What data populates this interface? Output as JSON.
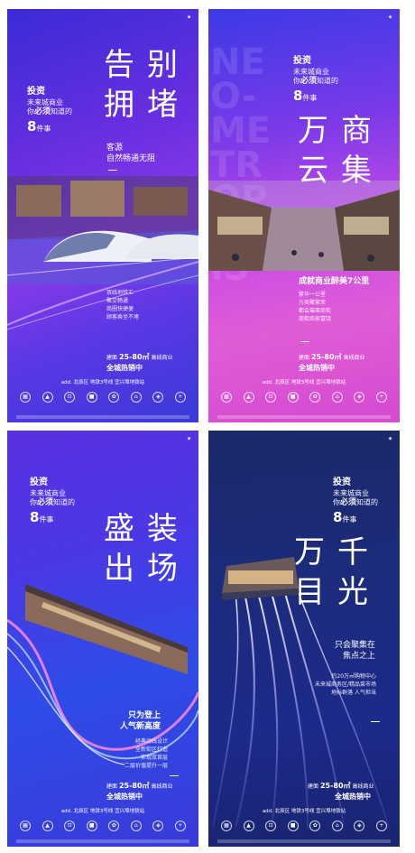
{
  "common": {
    "intro_title": "投资",
    "intro_line1": "未来城商业",
    "intro_line2_pre": "你",
    "intro_line2_bold": "必须",
    "intro_line2_post": "知道的",
    "intro_num": "8",
    "intro_suffix": "件事",
    "price_pre": "建面",
    "price_range": "25-80㎡",
    "price_post": "高线商业",
    "sale": "全城热销中",
    "address": "add. 北辰区 地铁3号线 宜兴埠地铁站"
  },
  "p1": {
    "title_chars": [
      "告",
      "别",
      "拥",
      "堵"
    ],
    "subtitle1": "客源",
    "subtitle2": "自然畅通无阻",
    "lines": [
      "双线地铁汇",
      "聚交畅通",
      "商圈快捷便",
      "顾客乘坐不堵"
    ]
  },
  "p2": {
    "watermark": "NEO-METROPOLIS",
    "title_chars": [
      "万",
      "商",
      "云",
      "集"
    ],
    "subtitle": "成就商业醉美7公里",
    "lines": [
      "繁华一公里",
      "万商聚繁荣",
      "都会璀璨商街",
      "商街商家富饶"
    ]
  },
  "p3": {
    "title_chars": [
      "盛",
      "装",
      "出",
      "场"
    ],
    "subtitle1": "只为登上",
    "subtitle2": "人气新高度",
    "lines": [
      "经典动线设计",
      "全新街区打造",
      "实现双首层",
      "二层价值提升一层"
    ]
  },
  "p4": {
    "title_chars": [
      "万",
      "千",
      "目",
      "光"
    ],
    "subtitle1": "只会聚集在",
    "subtitle2": "焦点之上",
    "lines": [
      "约20万㎡购物中心",
      "未来城商务区/精品菜市场",
      "地标群落 人气担当"
    ]
  },
  "colors": {
    "p1": "#6a2fe0",
    "p2": "#c94be6",
    "p3": "#2e4ce8",
    "p4": "#1d2b7e"
  }
}
